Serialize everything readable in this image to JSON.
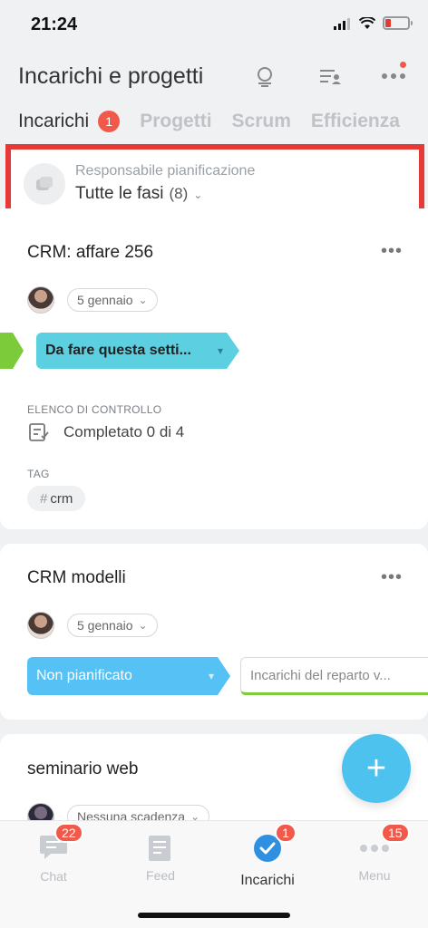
{
  "status": {
    "time": "21:24"
  },
  "header": {
    "title": "Incarichi e progetti"
  },
  "tabs": [
    {
      "label": "Incarichi",
      "badge": "1"
    },
    {
      "label": "Progetti"
    },
    {
      "label": "Scrum"
    },
    {
      "label": "Efficienza"
    }
  ],
  "filter": {
    "label": "Responsabile pianificazione",
    "value": "Tutte le fasi",
    "count": "(8)"
  },
  "cards": [
    {
      "title": "CRM: affare 256",
      "date": "5 gennaio",
      "stage": "Da fare questa setti...",
      "checklist_label": "ELENCO DI CONTROLLO",
      "checklist_value": "Completato 0 di 4",
      "tag_label": "TAG",
      "tag_hash": "#",
      "tag_value": "crm"
    },
    {
      "title": "CRM modelli",
      "date": "5 gennaio",
      "stage": "Non pianificato",
      "other_stage": "Incarichi del reparto v..."
    },
    {
      "title": "seminario web",
      "date": "Nessuna scadenza"
    }
  ],
  "fab": {
    "symbol": "+"
  },
  "bottom_nav": [
    {
      "label": "Chat",
      "badge": "22"
    },
    {
      "label": "Feed"
    },
    {
      "label": "Incarichi",
      "badge": "1"
    },
    {
      "label": "Menu",
      "badge": "15"
    }
  ],
  "colors": {
    "accent": "#4ec2ee",
    "badge": "#f15a4a",
    "highlight": "#e53a35",
    "stage_teal": "#5ccfe0",
    "stage_blue": "#55c1f5",
    "green": "#7ccb3a"
  }
}
